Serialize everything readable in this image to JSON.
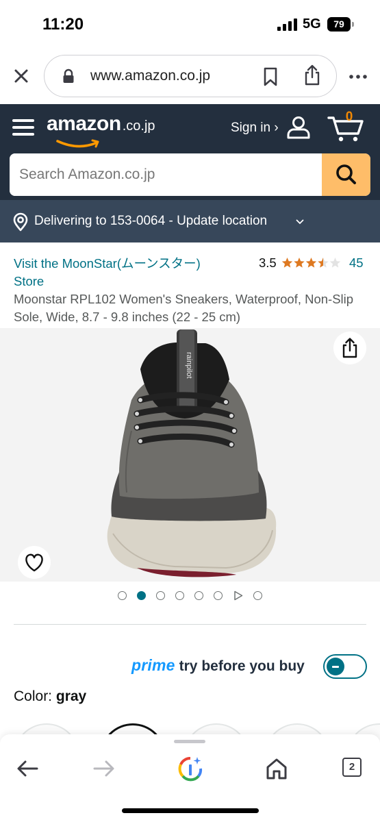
{
  "status_bar": {
    "time": "11:20",
    "network": "5G",
    "battery": "79"
  },
  "browser": {
    "url": "www.amazon.co.jp",
    "icons": [
      "close-icon",
      "lock-icon",
      "bookmark-icon",
      "share-icon",
      "more-icon"
    ]
  },
  "header": {
    "logo_main": "amazon",
    "logo_tld": ".co.jp",
    "signin_label": "Sign in ›",
    "cart_count": "0",
    "search_placeholder": "Search Amazon.co.jp"
  },
  "delivery": {
    "text": "Delivering to 153-0064 - Update location"
  },
  "product": {
    "store_link": "Visit the MoonStar(ムーンスター) Store",
    "rating_value": "3.5",
    "rating_stars": 3.5,
    "rating_count": "45",
    "title": "Moonstar RPL102 Women's Sneakers, Waterproof, Non-Slip Sole, Wide, 8.7 - 9.8 inches (22 - 25 cm)",
    "shoe_brand_print": "rainpilot"
  },
  "gallery": {
    "dot_count": 7,
    "active_index": 1,
    "has_video": true
  },
  "prime": {
    "brand": "prime",
    "label": "try before you buy",
    "toggle_on": false
  },
  "color": {
    "label": "Color:",
    "value": "gray"
  },
  "toolbar": {
    "tab_count": "2",
    "icons": [
      "back-arrow-icon",
      "forward-arrow-icon",
      "google-lens-icon",
      "home-icon",
      "tabs-icon"
    ]
  },
  "colors": {
    "header_bg": "#232f3e",
    "delivery_bg": "#37475a",
    "link": "#007185",
    "search_button": "#febd69",
    "cart_count": "#f08804",
    "prime_blue": "#1399ff"
  }
}
